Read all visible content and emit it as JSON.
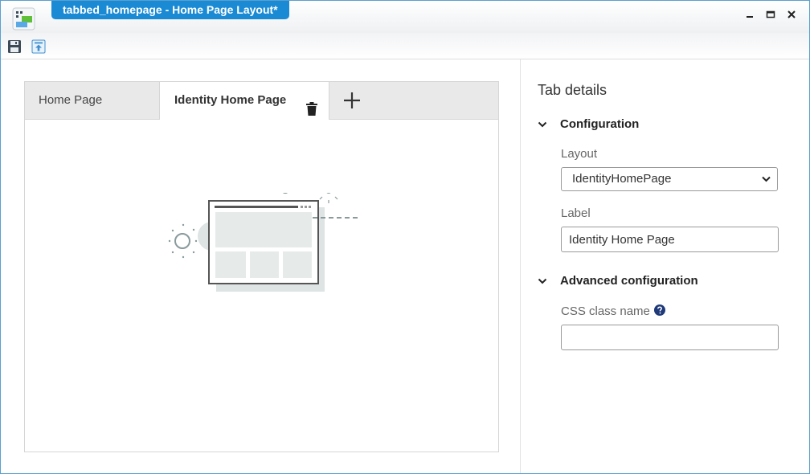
{
  "window": {
    "title": "tabbed_homepage - Home Page Layout*"
  },
  "toolbar": {
    "save_icon": "save-icon",
    "publish_icon": "publish-icon"
  },
  "tabs": [
    {
      "label": "Home Page",
      "active": false
    },
    {
      "label": "Identity Home Page",
      "active": true
    }
  ],
  "tab_details": {
    "title": "Tab details",
    "configuration": {
      "heading": "Configuration",
      "layout_label": "Layout",
      "layout_value": "IdentityHomePage",
      "label_label": "Label",
      "label_value": "Identity Home Page"
    },
    "advanced": {
      "heading": "Advanced configuration",
      "css_label": "CSS class name",
      "css_value": ""
    }
  },
  "colors": {
    "accent": "#1a8ad4",
    "help_icon": "#1f3a7a"
  }
}
